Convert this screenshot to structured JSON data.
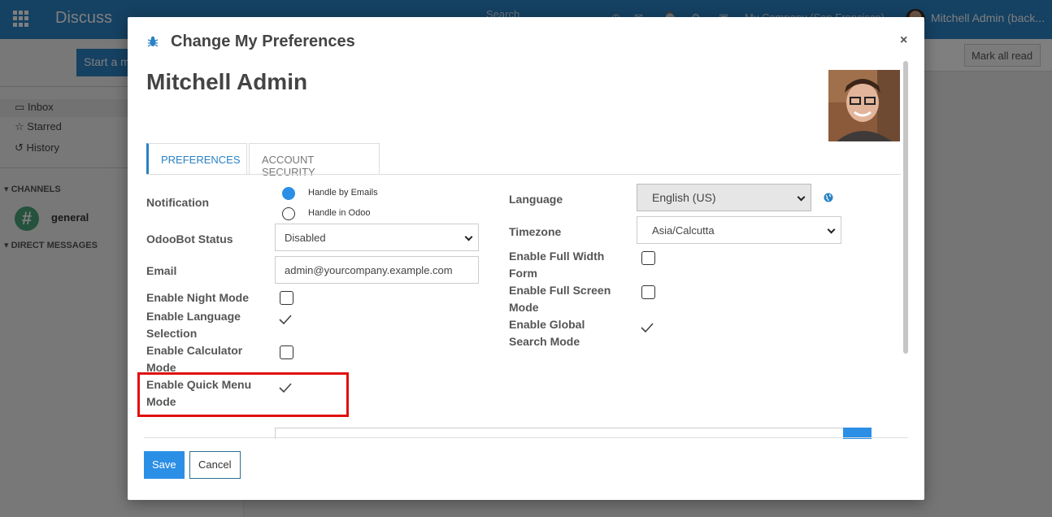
{
  "app": {
    "title": "Discuss",
    "search_placeholder": "Search",
    "company": "My Company (San Francisco)",
    "user": "Mitchell Admin (back..."
  },
  "sidebar": {
    "start_button": "Start a m",
    "items": [
      {
        "label": "Inbox",
        "icon": "inbox-icon"
      },
      {
        "label": "Starred",
        "icon": "star-icon"
      },
      {
        "label": "History",
        "icon": "history-icon"
      }
    ],
    "channels_header": "CHANNELS",
    "channel": "general",
    "dm_header": "DIRECT MESSAGES"
  },
  "main": {
    "mark_all_read": "Mark all read"
  },
  "modal": {
    "title": "Change My Preferences",
    "close": "×",
    "user_name": "Mitchell Admin",
    "tabs": [
      {
        "label": "PREFERENCES",
        "active": true
      },
      {
        "label": "ACCOUNT SECURITY",
        "active": false
      }
    ],
    "left": {
      "notification_label": "Notification",
      "notification_options": [
        "Handle by Emails",
        "Handle in Odoo"
      ],
      "notification_selected": "Handle by Emails",
      "odoobot_label": "OdooBot Status",
      "odoobot_value": "Disabled",
      "email_label": "Email",
      "email_value": "admin@yourcompany.example.com",
      "night_mode_label": "Enable Night Mode",
      "night_mode": false,
      "language_sel_label_1": "Enable Language",
      "language_sel_label_2": "Selection",
      "language_sel": true,
      "calculator_label_1": "Enable Calculator",
      "calculator_label_2": "Mode",
      "calculator": false,
      "quick_menu_label_1": "Enable Quick Menu",
      "quick_menu_label_2": "Mode",
      "quick_menu": true
    },
    "right": {
      "language_label": "Language",
      "language_value": "English (US)",
      "timezone_label": "Timezone",
      "timezone_value": "Asia/Calcutta",
      "full_width_label_1": "Enable Full Width",
      "full_width_label_2": "Form",
      "full_width": false,
      "full_screen_label_1": "Enable Full Screen",
      "full_screen_label_2": "Mode",
      "full_screen": false,
      "global_search_label_1": "Enable Global",
      "global_search_label_2": "Search Mode",
      "global_search": true
    },
    "footer": {
      "save": "Save",
      "cancel": "Cancel"
    }
  },
  "colors": {
    "primary": "#2b82c4",
    "button": "#2b8fe6",
    "highlight": "#e01010"
  }
}
